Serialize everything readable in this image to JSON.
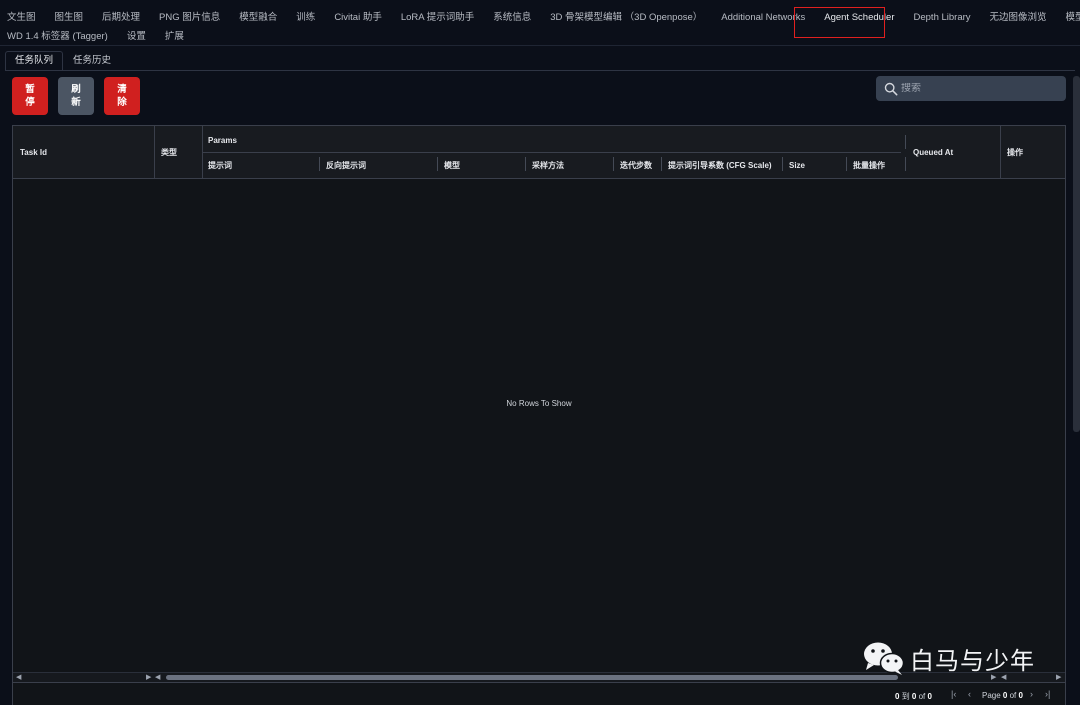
{
  "nav": {
    "row1": [
      "文生图",
      "图生图",
      "后期处理",
      "PNG 图片信息",
      "模型融合",
      "训练",
      "Civitai 助手",
      "LoRA 提示词助手",
      "系统信息",
      "3D 骨架模型编辑 （3D Openpose）",
      "Additional Networks",
      "Agent Scheduler",
      "Depth Library",
      "无边图像浏览",
      "模型转换"
    ],
    "row2": [
      "WD 1.4 标签器 (Tagger)",
      "设置",
      "扩展"
    ],
    "active": "Agent Scheduler"
  },
  "subtabs": [
    "任务队列",
    "任务历史"
  ],
  "buttons": {
    "pause": "暂停",
    "refresh": "刷新",
    "clear": "清除"
  },
  "search": {
    "placeholder": "搜索"
  },
  "grid": {
    "columns": {
      "task_id": "Task Id",
      "type": "类型",
      "params": "Params",
      "queued_at": "Queued At",
      "actions": "操作"
    },
    "params_columns": [
      "提示词",
      "反向提示词",
      "模型",
      "采样方法",
      "迭代步数",
      "提示词引导系数 (CFG Scale)",
      "Size",
      "批量操作"
    ],
    "empty_text": "No Rows To Show"
  },
  "pager": {
    "from": "0",
    "to_word": "到",
    "to": "0",
    "of_word": "of",
    "total": "0",
    "page_word": "Page",
    "page": "0",
    "pages": "0"
  },
  "watermark": {
    "text": "白马与少年"
  },
  "colors": {
    "background": "#0b0f19",
    "danger": "#d0201f",
    "secondary": "#4b5563",
    "highlight": "#e0201f"
  }
}
